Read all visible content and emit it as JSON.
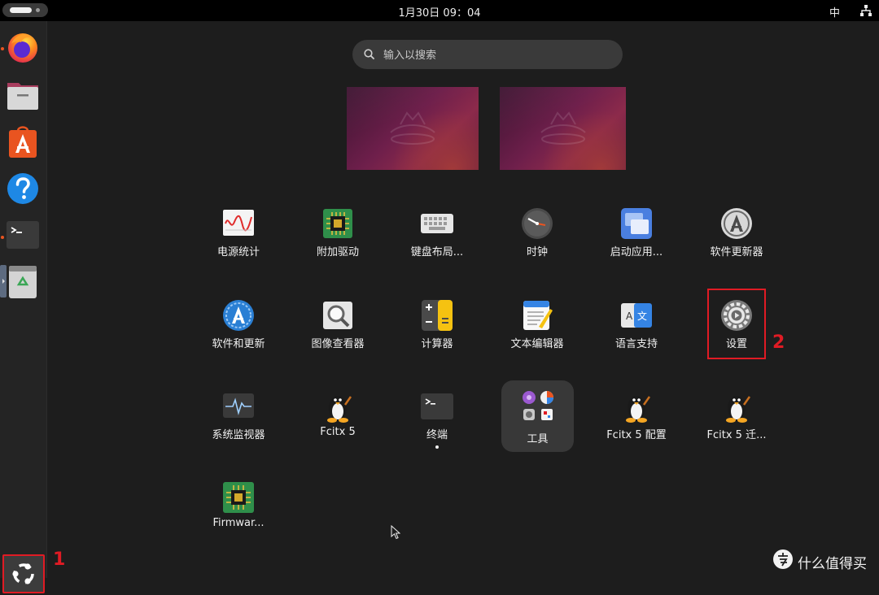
{
  "topbar": {
    "clock": "1月30日  09：04",
    "ime": "中"
  },
  "search": {
    "placeholder": "输入以搜索"
  },
  "apps": [
    {
      "label": "电源统计",
      "icon": "power-statistics-icon"
    },
    {
      "label": "附加驱动",
      "icon": "additional-drivers-chip-icon"
    },
    {
      "label": "键盘布局...",
      "icon": "keyboard-layout-icon"
    },
    {
      "label": "时钟",
      "icon": "clock-icon"
    },
    {
      "label": "启动应用...",
      "icon": "startup-applications-icon"
    },
    {
      "label": "软件更新器",
      "icon": "software-updater-icon"
    },
    {
      "label": "软件和更新",
      "icon": "software-and-updates-icon"
    },
    {
      "label": "图像查看器",
      "icon": "image-viewer-icon"
    },
    {
      "label": "计算器",
      "icon": "calculator-icon"
    },
    {
      "label": "文本编辑器",
      "icon": "text-editor-icon"
    },
    {
      "label": "语言支持",
      "icon": "language-support-icon"
    },
    {
      "label": "设置",
      "icon": "settings-gear-icon"
    },
    {
      "label": "系统监视器",
      "icon": "system-monitor-icon"
    },
    {
      "label": "Fcitx 5",
      "icon": "penguin-icon"
    },
    {
      "label": "终端",
      "icon": "terminal-icon"
    },
    {
      "label": "工具",
      "icon": "utilities-folder-icon"
    },
    {
      "label": "Fcitx 5 配置",
      "icon": "penguin-icon"
    },
    {
      "label": "Fcitx 5 迁...",
      "icon": "penguin-icon"
    },
    {
      "label": "Firmwar...",
      "icon": "firmware-chip-icon"
    }
  ],
  "dock": [
    {
      "name": "firefox",
      "icon": "firefox-icon",
      "running": true
    },
    {
      "name": "files",
      "icon": "files-icon",
      "running": false
    },
    {
      "name": "app-center",
      "icon": "app-center-icon",
      "running": false
    },
    {
      "name": "help",
      "icon": "help-icon",
      "running": false
    },
    {
      "name": "terminal",
      "icon": "terminal-icon",
      "running": true
    },
    {
      "name": "trash",
      "icon": "trash-icon",
      "running": false
    }
  ],
  "annotations": {
    "first": "1",
    "second": "2"
  },
  "watermark": {
    "text": "什么值得买"
  },
  "colors": {
    "accent": "#e95420",
    "annotation_red": "#e01b24",
    "background": "#1d1d1d"
  }
}
